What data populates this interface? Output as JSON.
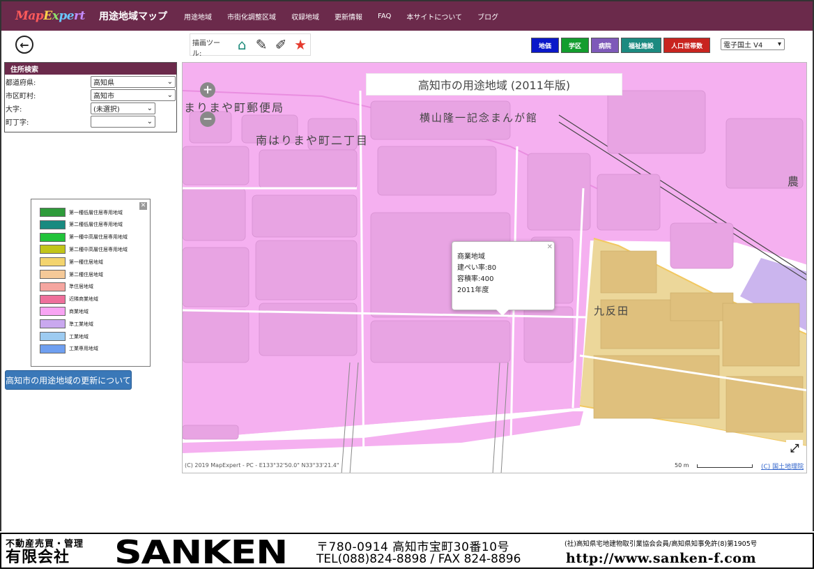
{
  "nav": {
    "logo": [
      "Map",
      "E",
      "x",
      "pe",
      "rt"
    ],
    "title": "用途地域マップ",
    "links": [
      "用途地域",
      "市街化調整区域",
      "収録地域",
      "更新情報",
      "FAQ",
      "本サイトについて",
      "ブログ"
    ]
  },
  "toolbar": {
    "draw_label": "描画ツール:",
    "tools": [
      {
        "icon": "house-icon",
        "glyph": "⌂"
      },
      {
        "icon": "pencil-icon",
        "glyph": "✎"
      },
      {
        "icon": "pencil-box-icon",
        "glyph": "✐"
      },
      {
        "icon": "star-icon",
        "glyph": "★"
      }
    ],
    "overlays": [
      {
        "label": "地価",
        "color": "#0b18c9"
      },
      {
        "label": "学区",
        "color": "#139d2e"
      },
      {
        "label": "病院",
        "color": "#7e59b9"
      },
      {
        "label": "福祉施設",
        "color": "#1c8a80"
      },
      {
        "label": "人口世帯数",
        "color": "#c8241f"
      }
    ],
    "map_type": "電子国土 V4"
  },
  "address_search": {
    "title": "住所検索",
    "rows": [
      {
        "label": "都道府県:",
        "value": "高知県"
      },
      {
        "label": "市区町村:",
        "value": "高知市"
      },
      {
        "label": "大字:",
        "value": "(未選択)"
      },
      {
        "label": "町丁字:",
        "value": ""
      }
    ]
  },
  "legend": {
    "items": [
      {
        "label": "第一種低層住居専用地域",
        "color": "#2e9b3a"
      },
      {
        "label": "第二種低層住居専用地域",
        "color": "#188a80"
      },
      {
        "label": "第一種中高層住居専用地域",
        "color": "#21c33a"
      },
      {
        "label": "第二種中高層住居専用地域",
        "color": "#c2c51a"
      },
      {
        "label": "第一種住居地域",
        "color": "#f3d46e"
      },
      {
        "label": "第二種住居地域",
        "color": "#f5c998"
      },
      {
        "label": "準住居地域",
        "color": "#f5a6a0"
      },
      {
        "label": "近隣商業地域",
        "color": "#ee6f9b"
      },
      {
        "label": "商業地域",
        "color": "#f8a4f3"
      },
      {
        "label": "準工業地域",
        "color": "#c9a8ef"
      },
      {
        "label": "工業地域",
        "color": "#9dcbf1"
      },
      {
        "label": "工業専用地域",
        "color": "#6f9ff0"
      }
    ]
  },
  "update_button": "高知市の用途地域の更新について",
  "map": {
    "title": "高知市の用途地域 (2011年版)",
    "labels": {
      "post_office": "まりまや町郵便局",
      "manga_museum": "横山隆一記念まんが館",
      "block_2": "南はりまや町二丁目",
      "kutanda": "九反田",
      "nou": "農"
    },
    "popup": {
      "zone": "商業地域",
      "coverage": "建ぺい率:80",
      "far": "容積率:400",
      "year": "2011年度"
    },
    "attribution": "(C) 2019 MapExpert - PC - E133°32'50.0\" N33°33'21.4\"",
    "scale": "50 m",
    "credit": "(C) 国土地理院"
  },
  "banner": {
    "line1": "不動産売買・管理",
    "line2": "有限会社",
    "name": "SANKEN",
    "address": "〒780-0914 高知市宝町30番10号",
    "tel": "TEL(088)824-8898 / FAX 824-8896",
    "association": "(社)高知県宅地建物取引業協会会員/高知県知事免許(8)第1905号",
    "url": "http://www.sanken-f.com"
  }
}
